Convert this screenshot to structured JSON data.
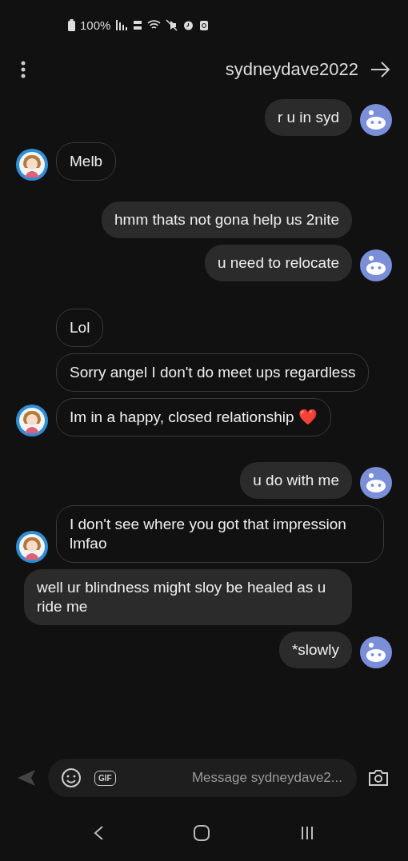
{
  "status_bar": {
    "battery": "100%"
  },
  "header": {
    "title": "sydneydave2022"
  },
  "messages": [
    {
      "kind": "incoming",
      "text": "r u in syd",
      "avatar": true
    },
    {
      "kind": "outgoing",
      "text": "Melb",
      "avatar": true
    },
    {
      "kind": "incoming",
      "text": "hmm thats not gona help us 2nite",
      "avatar": false
    },
    {
      "kind": "incoming",
      "text": "u need to relocate",
      "avatar": true
    },
    {
      "kind": "outgoing",
      "text": "Lol",
      "avatar": false
    },
    {
      "kind": "outgoing",
      "text": "Sorry angel I don't do meet ups regardless",
      "avatar": false
    },
    {
      "kind": "outgoing",
      "text": "Im in a happy, closed relationship ❤️",
      "avatar": true
    },
    {
      "kind": "incoming",
      "text": "u do with me",
      "avatar": true
    },
    {
      "kind": "outgoing",
      "text": "I don't see where you got that impression lmfao",
      "avatar": true
    },
    {
      "kind": "incoming",
      "text": "well ur blindness might sloy be healed as u ride me",
      "avatar": false
    },
    {
      "kind": "incoming",
      "text": "*slowly",
      "avatar": true
    }
  ],
  "composer": {
    "placeholder": "Message sydneydave2...",
    "gif_label": "GIF"
  }
}
